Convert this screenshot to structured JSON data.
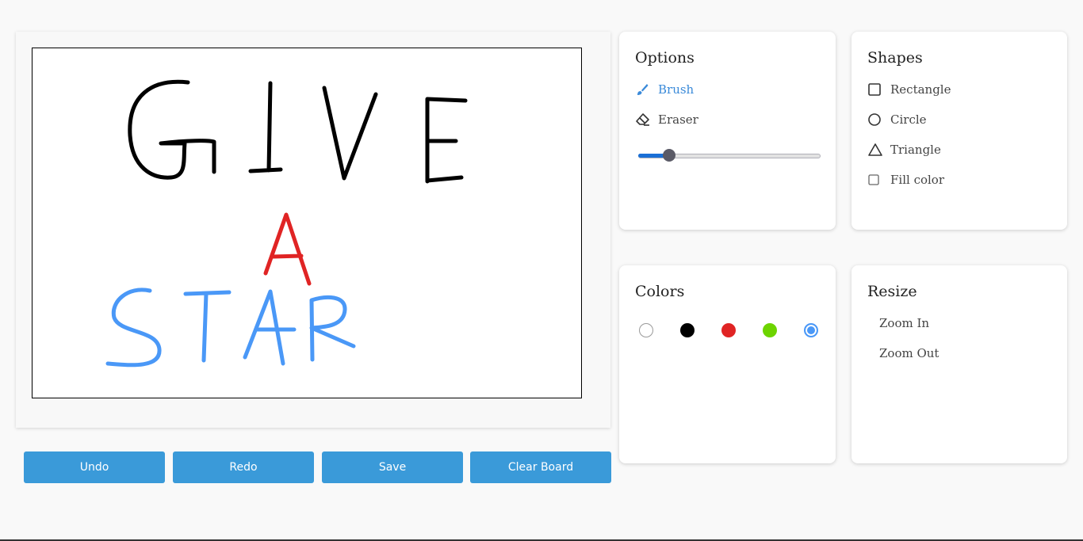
{
  "actions": {
    "undo": "Undo",
    "redo": "Redo",
    "save": "Save",
    "clear": "Clear Board"
  },
  "options": {
    "title": "Options",
    "brush": "Brush",
    "eraser": "Eraser",
    "active_tool": "brush",
    "brush_size_fraction": 0.17
  },
  "shapes": {
    "title": "Shapes",
    "rectangle": "Rectangle",
    "circle": "Circle",
    "triangle": "Triangle",
    "fill_color": "Fill color",
    "fill_checked": false
  },
  "colors": {
    "title": "Colors",
    "swatches": [
      "#ffffff",
      "#000000",
      "#e02424",
      "#6dd400",
      "#4a98f7"
    ],
    "selected": "#4a98f7"
  },
  "resize": {
    "title": "Resize",
    "zoom_in": "Zoom In",
    "zoom_out": "Zoom Out"
  },
  "drawing": {
    "strokes": [
      {
        "color": "#000000",
        "text": "GIVE"
      },
      {
        "color": "#e02424",
        "text": "A"
      },
      {
        "color": "#4a98f7",
        "text": "STAR"
      }
    ]
  }
}
